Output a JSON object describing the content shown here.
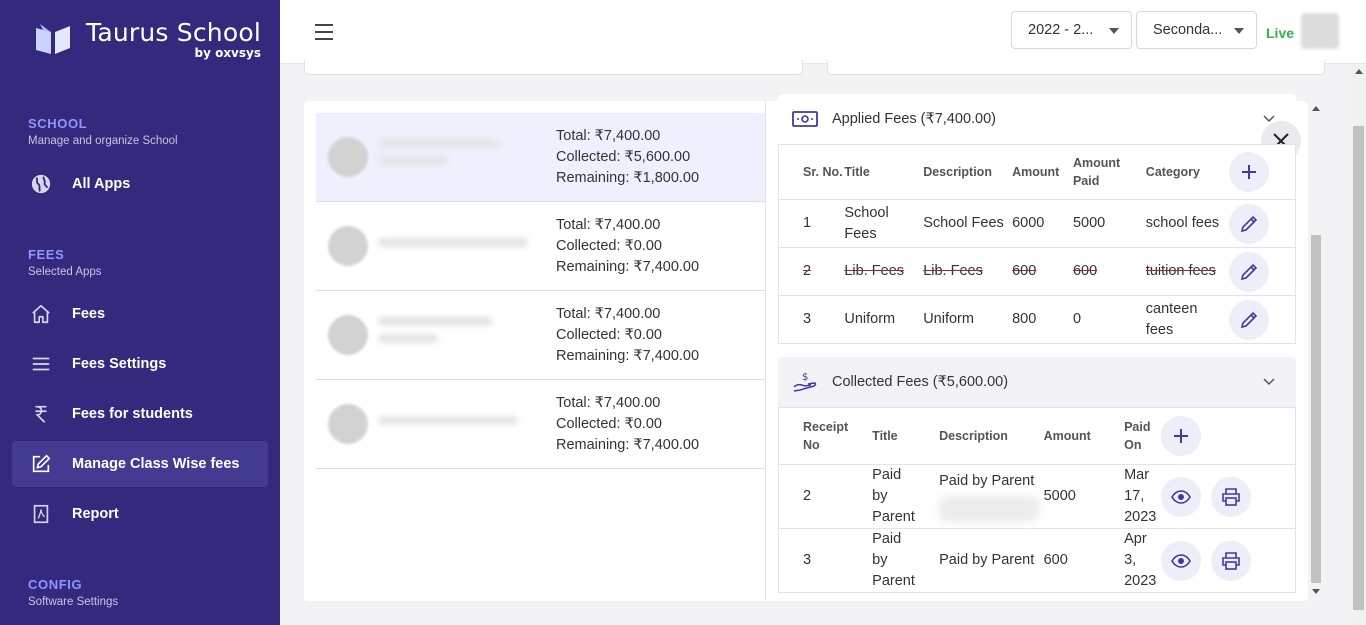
{
  "brand": {
    "name": "Taurus School",
    "by": "by oxvsys"
  },
  "sidebar": {
    "sections": [
      {
        "title": "SCHOOL",
        "subtitle": "Manage and organize School"
      },
      {
        "title": "FEES",
        "subtitle": "Selected Apps"
      },
      {
        "title": "CONFIG",
        "subtitle": "Software Settings"
      }
    ],
    "items": [
      {
        "label": "All Apps",
        "icon": "globe-icon"
      },
      {
        "label": "Fees",
        "icon": "home-icon"
      },
      {
        "label": "Fees Settings",
        "icon": "menu-icon"
      },
      {
        "label": "Fees for students",
        "icon": "rupee-icon"
      },
      {
        "label": "Manage Class Wise fees",
        "icon": "edit-icon",
        "active": true
      },
      {
        "label": "Report",
        "icon": "pdf-icon"
      }
    ]
  },
  "topbar": {
    "year_select": "2022 - 2...",
    "class_select": "Seconda...",
    "status": "Live"
  },
  "students": [
    {
      "total": "Total: ₹7,400.00",
      "collected": "Collected: ₹5,600.00",
      "remaining": "Remaining: ₹1,800.00"
    },
    {
      "total": "Total: ₹7,400.00",
      "collected": "Collected: ₹0.00",
      "remaining": "Remaining: ₹7,400.00"
    },
    {
      "total": "Total: ₹7,400.00",
      "collected": "Collected: ₹0.00",
      "remaining": "Remaining: ₹7,400.00"
    },
    {
      "total": "Total: ₹7,400.00",
      "collected": "Collected: ₹0.00",
      "remaining": "Remaining: ₹7,400.00"
    }
  ],
  "applied": {
    "title": "Applied Fees (₹7,400.00)",
    "headers": {
      "sr": "Sr. No.",
      "title": "Title",
      "description": "Description",
      "amount": "Amount",
      "paid": "Amount Paid",
      "category": "Category"
    },
    "rows": [
      {
        "sr": "1",
        "title": "School Fees",
        "description": "School Fees",
        "amount": "6000",
        "paid": "5000",
        "category": "school fees"
      },
      {
        "sr": "2",
        "title": "Lib. Fees",
        "description": "Lib. Fees",
        "amount": "600",
        "paid": "600",
        "category": "tuition fees"
      },
      {
        "sr": "3",
        "title": "Uniform",
        "description": "Uniform",
        "amount": "800",
        "paid": "0",
        "category": "canteen fees"
      }
    ]
  },
  "collected": {
    "title": "Collected Fees (₹5,600.00)",
    "headers": {
      "receipt": "Receipt No",
      "title": "Title",
      "description": "Description",
      "amount": "Amount",
      "paid_on": "Paid On"
    },
    "rows": [
      {
        "receipt": "2",
        "title": "Paid by Parent",
        "description": "Paid by Parent",
        "amount": "5000",
        "paid_on": "Mar 17, 2023"
      },
      {
        "receipt": "3",
        "title": "Paid by Parent",
        "description": "Paid by Parent",
        "amount": "600",
        "paid_on": "Apr 3, 2023"
      }
    ]
  },
  "colors": {
    "sidebar": "#33297d",
    "accent": "#3f3aa3",
    "live": "#2fb64a",
    "section": "#8f97ff"
  }
}
